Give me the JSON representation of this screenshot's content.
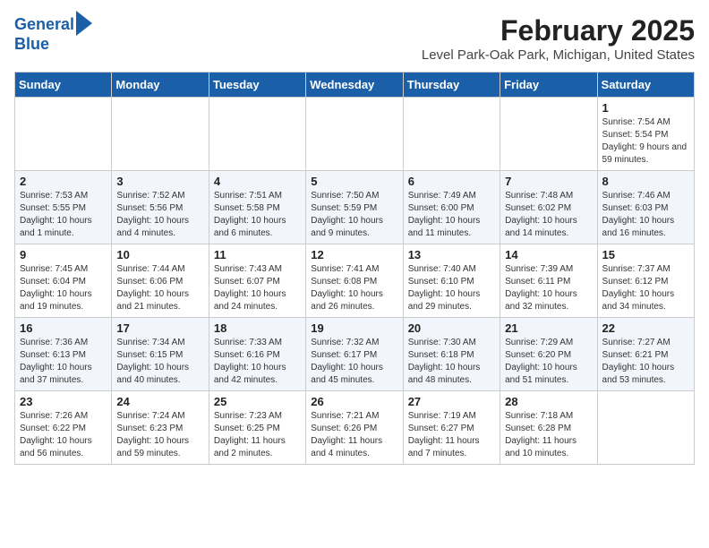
{
  "header": {
    "logo_line1": "General",
    "logo_line2": "Blue",
    "month_title": "February 2025",
    "location": "Level Park-Oak Park, Michigan, United States"
  },
  "weekdays": [
    "Sunday",
    "Monday",
    "Tuesday",
    "Wednesday",
    "Thursday",
    "Friday",
    "Saturday"
  ],
  "weeks": [
    [
      {
        "day": "",
        "info": ""
      },
      {
        "day": "",
        "info": ""
      },
      {
        "day": "",
        "info": ""
      },
      {
        "day": "",
        "info": ""
      },
      {
        "day": "",
        "info": ""
      },
      {
        "day": "",
        "info": ""
      },
      {
        "day": "1",
        "info": "Sunrise: 7:54 AM\nSunset: 5:54 PM\nDaylight: 9 hours and 59 minutes."
      }
    ],
    [
      {
        "day": "2",
        "info": "Sunrise: 7:53 AM\nSunset: 5:55 PM\nDaylight: 10 hours and 1 minute."
      },
      {
        "day": "3",
        "info": "Sunrise: 7:52 AM\nSunset: 5:56 PM\nDaylight: 10 hours and 4 minutes."
      },
      {
        "day": "4",
        "info": "Sunrise: 7:51 AM\nSunset: 5:58 PM\nDaylight: 10 hours and 6 minutes."
      },
      {
        "day": "5",
        "info": "Sunrise: 7:50 AM\nSunset: 5:59 PM\nDaylight: 10 hours and 9 minutes."
      },
      {
        "day": "6",
        "info": "Sunrise: 7:49 AM\nSunset: 6:00 PM\nDaylight: 10 hours and 11 minutes."
      },
      {
        "day": "7",
        "info": "Sunrise: 7:48 AM\nSunset: 6:02 PM\nDaylight: 10 hours and 14 minutes."
      },
      {
        "day": "8",
        "info": "Sunrise: 7:46 AM\nSunset: 6:03 PM\nDaylight: 10 hours and 16 minutes."
      }
    ],
    [
      {
        "day": "9",
        "info": "Sunrise: 7:45 AM\nSunset: 6:04 PM\nDaylight: 10 hours and 19 minutes."
      },
      {
        "day": "10",
        "info": "Sunrise: 7:44 AM\nSunset: 6:06 PM\nDaylight: 10 hours and 21 minutes."
      },
      {
        "day": "11",
        "info": "Sunrise: 7:43 AM\nSunset: 6:07 PM\nDaylight: 10 hours and 24 minutes."
      },
      {
        "day": "12",
        "info": "Sunrise: 7:41 AM\nSunset: 6:08 PM\nDaylight: 10 hours and 26 minutes."
      },
      {
        "day": "13",
        "info": "Sunrise: 7:40 AM\nSunset: 6:10 PM\nDaylight: 10 hours and 29 minutes."
      },
      {
        "day": "14",
        "info": "Sunrise: 7:39 AM\nSunset: 6:11 PM\nDaylight: 10 hours and 32 minutes."
      },
      {
        "day": "15",
        "info": "Sunrise: 7:37 AM\nSunset: 6:12 PM\nDaylight: 10 hours and 34 minutes."
      }
    ],
    [
      {
        "day": "16",
        "info": "Sunrise: 7:36 AM\nSunset: 6:13 PM\nDaylight: 10 hours and 37 minutes."
      },
      {
        "day": "17",
        "info": "Sunrise: 7:34 AM\nSunset: 6:15 PM\nDaylight: 10 hours and 40 minutes."
      },
      {
        "day": "18",
        "info": "Sunrise: 7:33 AM\nSunset: 6:16 PM\nDaylight: 10 hours and 42 minutes."
      },
      {
        "day": "19",
        "info": "Sunrise: 7:32 AM\nSunset: 6:17 PM\nDaylight: 10 hours and 45 minutes."
      },
      {
        "day": "20",
        "info": "Sunrise: 7:30 AM\nSunset: 6:18 PM\nDaylight: 10 hours and 48 minutes."
      },
      {
        "day": "21",
        "info": "Sunrise: 7:29 AM\nSunset: 6:20 PM\nDaylight: 10 hours and 51 minutes."
      },
      {
        "day": "22",
        "info": "Sunrise: 7:27 AM\nSunset: 6:21 PM\nDaylight: 10 hours and 53 minutes."
      }
    ],
    [
      {
        "day": "23",
        "info": "Sunrise: 7:26 AM\nSunset: 6:22 PM\nDaylight: 10 hours and 56 minutes."
      },
      {
        "day": "24",
        "info": "Sunrise: 7:24 AM\nSunset: 6:23 PM\nDaylight: 10 hours and 59 minutes."
      },
      {
        "day": "25",
        "info": "Sunrise: 7:23 AM\nSunset: 6:25 PM\nDaylight: 11 hours and 2 minutes."
      },
      {
        "day": "26",
        "info": "Sunrise: 7:21 AM\nSunset: 6:26 PM\nDaylight: 11 hours and 4 minutes."
      },
      {
        "day": "27",
        "info": "Sunrise: 7:19 AM\nSunset: 6:27 PM\nDaylight: 11 hours and 7 minutes."
      },
      {
        "day": "28",
        "info": "Sunrise: 7:18 AM\nSunset: 6:28 PM\nDaylight: 11 hours and 10 minutes."
      },
      {
        "day": "",
        "info": ""
      }
    ]
  ]
}
